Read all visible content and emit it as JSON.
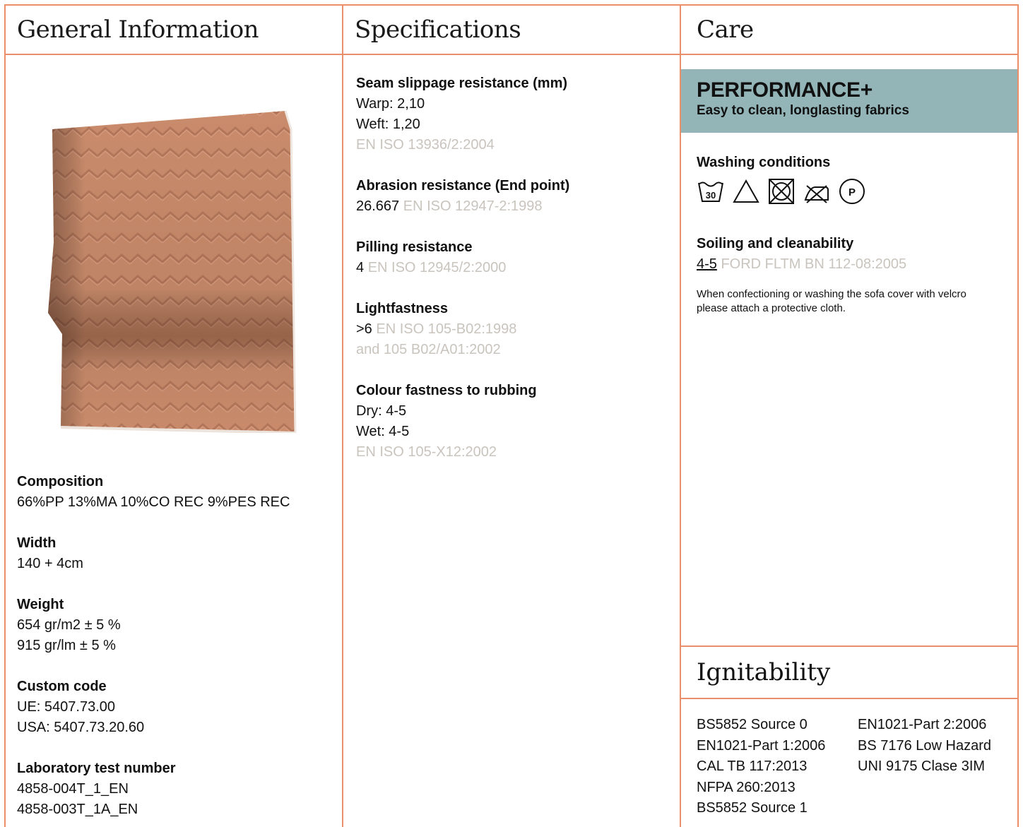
{
  "columns": {
    "general": "General Information",
    "specs": "Specifications",
    "care": "Care"
  },
  "general": {
    "composition": {
      "label": "Composition",
      "value": "66%PP 13%MA 10%CO REC 9%PES REC"
    },
    "width": {
      "label": "Width",
      "value": "140 + 4cm"
    },
    "weight": {
      "label": "Weight",
      "values": [
        "654 gr/m2 ± 5 %",
        "915 gr/lm ± 5 %"
      ]
    },
    "custom_code": {
      "label": "Custom code",
      "values": [
        "UE: 5407.73.00",
        "USA: 5407.73.20.60"
      ]
    },
    "lab_test": {
      "label": "Laboratory test number",
      "values": [
        "4858-004T_1_EN",
        "4858-003T_1A_EN"
      ]
    }
  },
  "specs": {
    "seam": {
      "label": "Seam slippage resistance (mm)",
      "values": [
        "Warp: 2,10",
        "Weft: 1,20"
      ],
      "standard": "EN ISO 13936/2:2004"
    },
    "abrasion": {
      "label": "Abrasion resistance (End point)",
      "value": "26.667",
      "standard": "EN ISO 12947-2:1998"
    },
    "pilling": {
      "label": "Pilling resistance",
      "value": "4",
      "standard": "EN ISO 12945/2:2000"
    },
    "light": {
      "label": "Lightfastness",
      "value": ">6",
      "standard": "EN ISO 105-B02:1998",
      "standard2": "and 105 B02/A01:2002"
    },
    "rubbing": {
      "label": "Colour fastness to rubbing",
      "values": [
        "Dry: 4-5",
        "Wet: 4-5"
      ],
      "standard": "EN ISO 105-X12:2002"
    }
  },
  "care": {
    "banner_title": "PERFORMANCE+",
    "banner_subtitle": "Easy to clean, longlasting fabrics",
    "banner_color": "#93b5b8",
    "washing_label": "Washing conditions",
    "wash_icons": [
      "wash-30-icon",
      "bleach-allowed-icon",
      "no-tumble-dry-icon",
      "no-iron-icon",
      "dry-clean-p-icon"
    ],
    "wash_temp": "30",
    "dry_clean_letter": "P",
    "soiling_label": "Soiling and cleanability",
    "soiling_value": "4-5",
    "soiling_standard": "FORD FLTM BN 112-08:2005",
    "note": "When confectioning or washing the sofa cover with velcro please attach a protective cloth."
  },
  "ignitability": {
    "title": "Ignitability",
    "col1": [
      "BS5852 Source 0",
      "EN1021-Part 1:2006",
      "CAL TB 117:2013",
      "NFPA 260:2013",
      "BS5852 Source 1"
    ],
    "col2": [
      "EN1021-Part 2:2006",
      "BS 7176 Low Hazard",
      "UNI 9175 Clase 3IM"
    ]
  },
  "colors": {
    "border": "#e9906a",
    "fabric": "#c98b6b",
    "muted_text": "#c9c4bd"
  }
}
